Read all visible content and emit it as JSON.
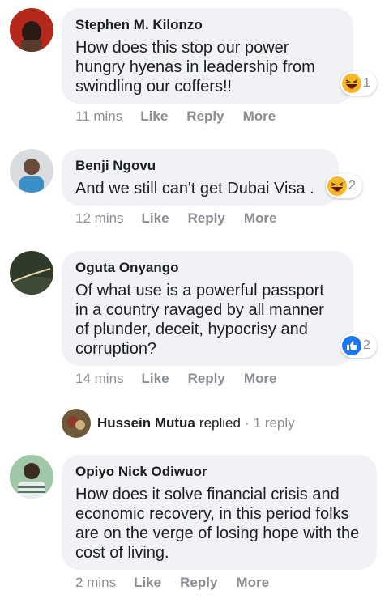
{
  "comments": [
    {
      "author": "Stephen M. Kilonzo",
      "text": "How does this stop our power hungry hyenas in leadership from swindling our coffers!!",
      "reaction": {
        "icon": "haha-emoji-icon",
        "count": "1"
      },
      "time": "11 mins",
      "actions": [
        "Like",
        "Reply",
        "More"
      ]
    },
    {
      "author": "Benji Ngovu",
      "text": "And we still can't get Dubai Visa .",
      "reaction": {
        "icon": "haha-emoji-icon",
        "count": "2"
      },
      "time": "12 mins",
      "actions": [
        "Like",
        "Reply",
        "More"
      ]
    },
    {
      "author": "Oguta Onyango",
      "text": "Of what use is a powerful passport in a country ravaged by all manner of plunder, deceit, hypocrisy and corruption?",
      "reaction": {
        "icon": "thumbs-up-like-icon",
        "count": "2"
      },
      "time": "14 mins",
      "actions": [
        "Like",
        "Reply",
        "More"
      ]
    },
    {
      "author": "Opiyo Nick Odiwuor",
      "text": "How does it solve financial crisis and economic recovery, in this period folks are on the verge of losing hope with the cost of living.",
      "time": "2 mins",
      "actions": [
        "Like",
        "Reply",
        "More"
      ]
    }
  ],
  "reply_summary": {
    "author": "Hussein Mutua",
    "verb": "replied",
    "separator": "·",
    "count_label": "1 reply"
  },
  "colors": {
    "bubble": "#f0f2f5",
    "muted_text": "#8a8d91",
    "like_blue": "#1877f2",
    "haha_yellow": "#f7b928"
  }
}
